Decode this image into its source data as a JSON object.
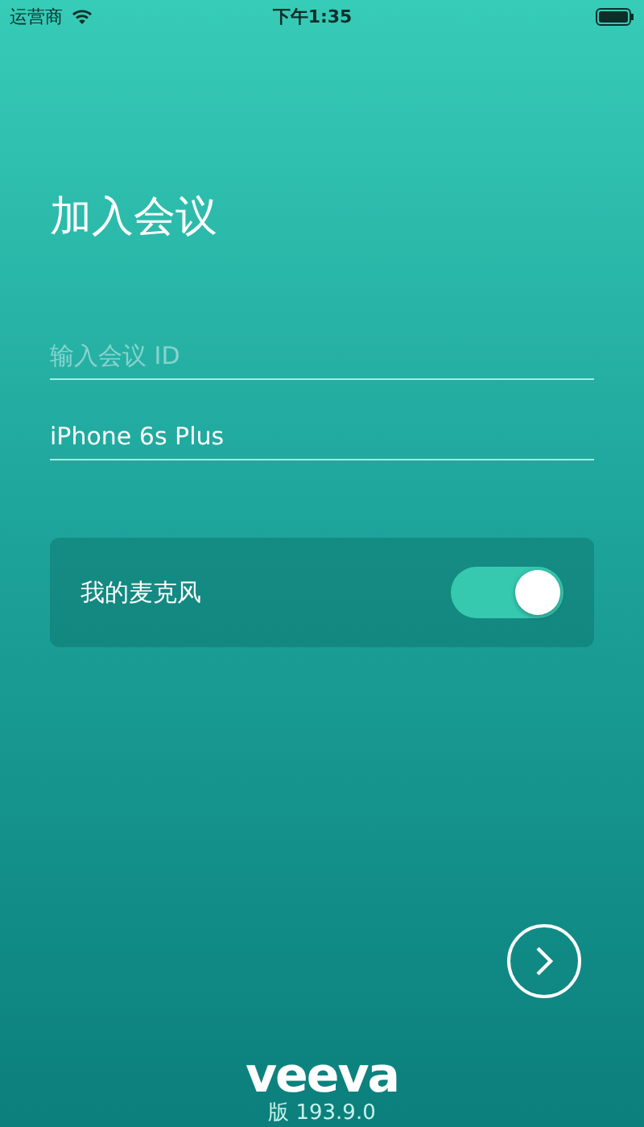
{
  "status_bar": {
    "carrier": "运营商",
    "time": "下午1:35"
  },
  "title": "加入会议",
  "meeting_id_field": {
    "placeholder": "输入会议 ID"
  },
  "name_field": {
    "value": "iPhone 6s Plus"
  },
  "microphone": {
    "label": "我的麦克风",
    "on": true
  },
  "logo": "veeva",
  "version": "版 193.9.0"
}
